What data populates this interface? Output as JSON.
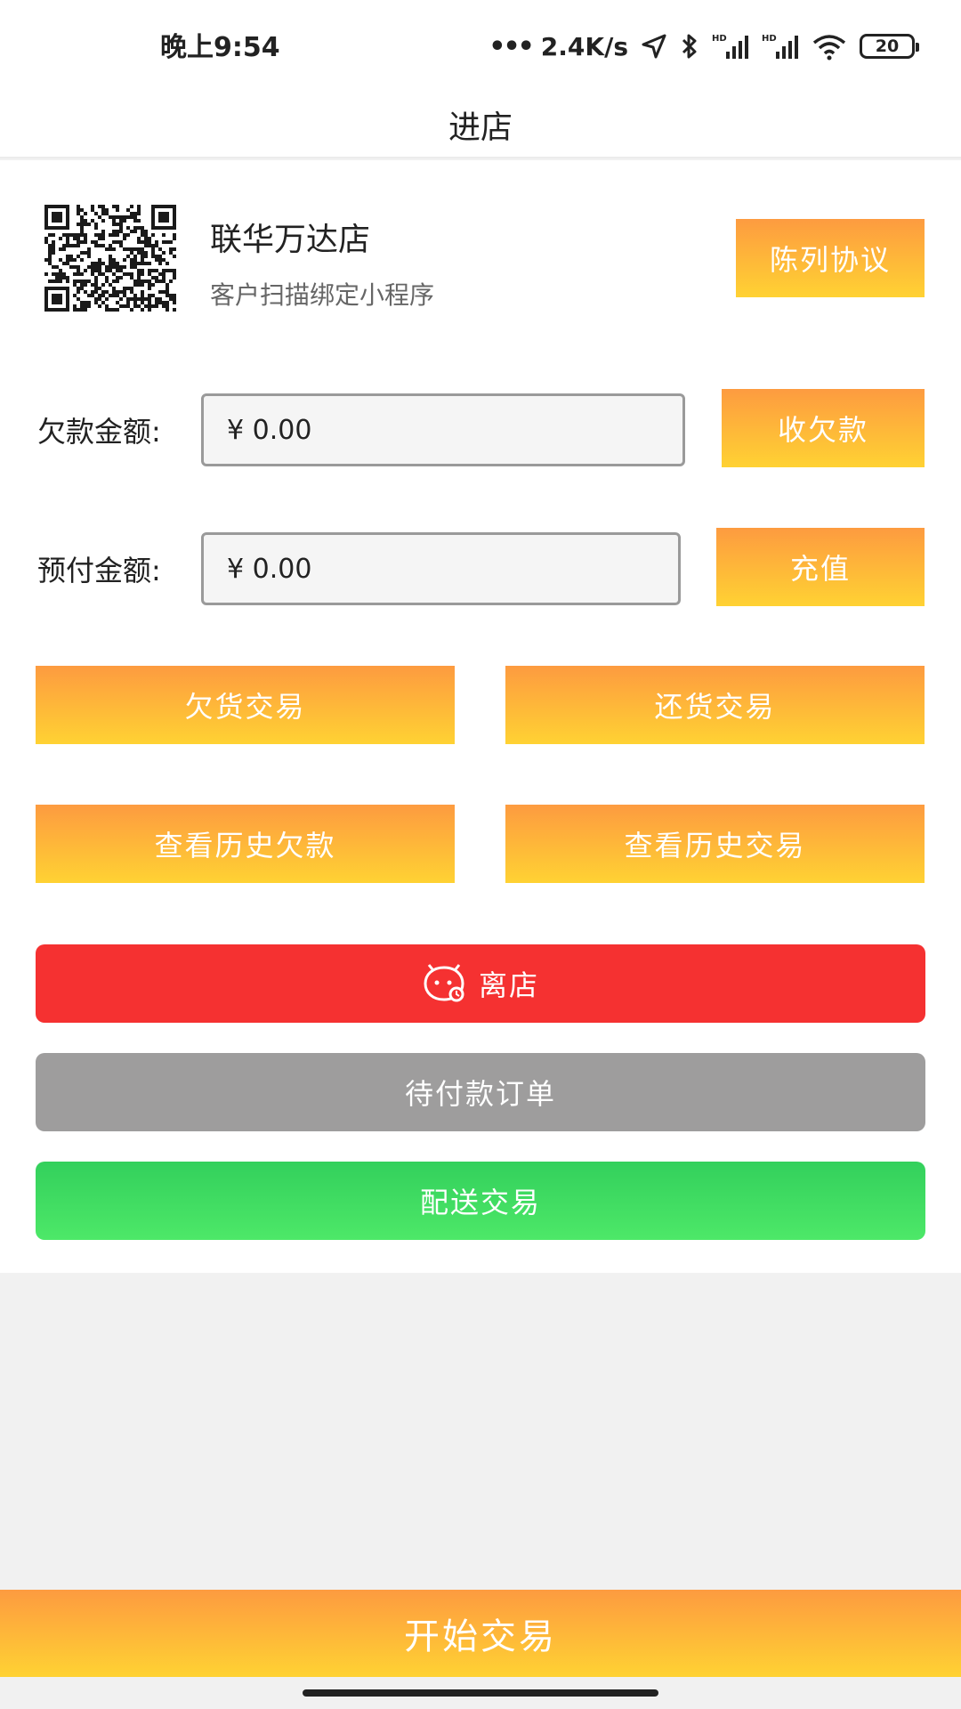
{
  "status_bar": {
    "time": "晚上9:54",
    "dots": "•••",
    "network_speed": "2.4K/s",
    "icons": [
      "location-arrow-icon",
      "bluetooth-icon",
      "signal-hd-icon",
      "signal-hd-icon",
      "wifi-icon"
    ],
    "battery": "20"
  },
  "header": {
    "title": "进店"
  },
  "store": {
    "name": "联华万达店",
    "subtitle": "客户扫描绑定小程序",
    "display_agreement_label": "陈列协议"
  },
  "debt": {
    "label": "欠款金额:",
    "value": "¥ 0.00",
    "button_label": "收欠款"
  },
  "prepaid": {
    "label": "预付金额:",
    "value": "¥ 0.00",
    "button_label": "充值"
  },
  "actions": {
    "owe_goods": "欠货交易",
    "return_goods": "还货交易",
    "history_debt": "查看历史欠款",
    "history_trade": "查看历史交易"
  },
  "leave": {
    "label": "离店",
    "icon": "leave-face-icon"
  },
  "pending_orders": {
    "label": "待付款订单"
  },
  "delivery": {
    "label": "配送交易"
  },
  "footer": {
    "start_label": "开始交易"
  },
  "colors": {
    "gradient_top": "#fd9b40",
    "gradient_bottom": "#ffd233",
    "leave_red": "#f53131",
    "pending_gray": "#9e9d9d",
    "delivery_green": "#3ddc62"
  }
}
